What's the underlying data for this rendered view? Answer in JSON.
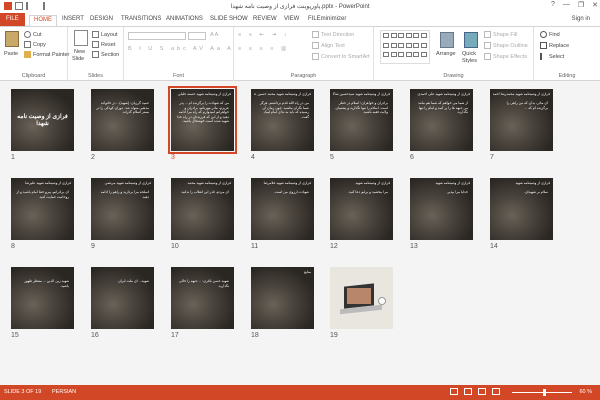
{
  "window": {
    "title": "پاورپوینت فرازی از وصیت نامه شهدا.pptx - PowerPoint",
    "controls": [
      "?",
      "—",
      "❐",
      "✕"
    ],
    "signin": "Sign in"
  },
  "tabs": [
    "FILE",
    "HOME",
    "INSERT",
    "DESIGN",
    "TRANSITIONS",
    "ANIMATIONS",
    "SLIDE SHOW",
    "REVIEW",
    "VIEW",
    "FILEminimizer"
  ],
  "ribbon": {
    "clipboard": {
      "label": "Clipboard",
      "paste": "Paste",
      "cut": "Cut",
      "copy": "Copy",
      "format_painter": "Format Painter"
    },
    "slides": {
      "label": "Slides",
      "new_slide": "New",
      "new_slide2": "Slide",
      "layout": "Layout",
      "reset": "Reset",
      "section": "Section"
    },
    "font": {
      "label": "Font"
    },
    "paragraph": {
      "label": "Paragraph",
      "text_direction": "Text Direction",
      "align_text": "Align Text",
      "convert_smartart": "Convert to SmartArt"
    },
    "drawing": {
      "label": "Drawing",
      "arrange": "Arrange",
      "quick_styles": "Quick",
      "quick_styles2": "Styles",
      "shape_fill": "Shape Fill",
      "shape_outline": "Shape Outline",
      "shape_effects": "Shape Effects"
    },
    "editing": {
      "label": "Editing",
      "find": "Find",
      "replace": "Replace",
      "select": "Select"
    }
  },
  "slides": [
    {
      "n": "1",
      "type": "title",
      "big": "فرازی از وصیت نامه شهدا"
    },
    {
      "n": "2",
      "type": "text",
      "hdr": "",
      "text": "حمید گرزیان: (شهید)... در خانواده مذهبی متولد شد. دوران کودکی را در بستر اسلام گذراند."
    },
    {
      "n": "3",
      "type": "text",
      "hdr": "فرازی از وصیتنامه شهید حسنه خلیلی",
      "text": "من که شهادت را برگزیده ام ... پدر عزیزم، مادر مهربانم، برادران و خواهرانم امیدوارم که راه مرا ادامه دهید و از این که فرزندتان در راه خدا شهید شده است خوشحال باشید."
    },
    {
      "n": "4",
      "type": "text",
      "hdr": "فرازی از وصیتنامه شهید محمد حسین عزیزی",
      "text": "من در راه الله قدم برداشتم. هرگز شما نگران نباشید. چون زمان آن رسیده که باید به ندای امام لبیک گفت."
    },
    {
      "n": "5",
      "type": "text",
      "hdr": "فرازی از وصیتنامه شهید سیدحسین شاکری",
      "text": "برادران و خواهران؛ اسلام در خطر است. اسلام را تنها نگذارید و پشتیبان ولایت فقیه باشید."
    },
    {
      "n": "6",
      "type": "text",
      "hdr": "فرازی از وصیتنامه شهید علی احمدی",
      "text": "از شما می خواهم که شما هم مانند من جبهه ها را پر کنید و امام را تنها نگذارید."
    },
    {
      "n": "7",
      "type": "text",
      "hdr": "فرازی از وصیتنامه شهید محمدرضا احمدی",
      "text": "ای مادر، بدان که من راهی را برگزیده ام که ..."
    },
    {
      "n": "8",
      "type": "text",
      "hdr": "فرازی از وصیتنامه شهید علیرضا",
      "text": "ای برادرانم، پیرو خط امام باشید و از روحانیت حمایت کنید."
    },
    {
      "n": "9",
      "type": "text",
      "hdr": "فرازی از وصیتنامه شهید مرتضی",
      "text": "اسلحه مرا بردارید و راهم را ادامه دهید."
    },
    {
      "n": "10",
      "type": "text",
      "hdr": "فرازی از وصیتنامه شهید محمد",
      "text": "ای مردم، قدر این انقلاب را بدانید."
    },
    {
      "n": "11",
      "type": "text",
      "hdr": "فرازی از وصیتنامه شهید غلامرضا",
      "text": "شهادت آرزوی من است."
    },
    {
      "n": "12",
      "type": "text",
      "hdr": "فرازی از وصیتنامه شهید",
      "text": "مرا ببخشید و برایم دعا کنید."
    },
    {
      "n": "13",
      "type": "text",
      "hdr": "فرازی از وصیتنامه شهید",
      "text": "خدایا مرا بپذیر."
    },
    {
      "n": "14",
      "type": "text",
      "hdr": "فرازی از وصیتنامه شهید",
      "text": "سلام بر شهیدان."
    },
    {
      "n": "15",
      "type": "text",
      "hdr": "",
      "text": "شهید زین الدین ... منتظر ظهور باشید."
    },
    {
      "n": "16",
      "type": "text",
      "hdr": "",
      "text": "شهید... ای ملت ایران"
    },
    {
      "n": "17",
      "type": "text",
      "hdr": "",
      "text": "شهید حسن باقری: ... جبهه را خالی نگذارید."
    },
    {
      "n": "18",
      "type": "text",
      "hdr": "منابع",
      "text": ""
    },
    {
      "n": "19",
      "type": "laptop"
    }
  ],
  "status": {
    "slide": "SLIDE 3 OF 19",
    "language": "PERSIAN",
    "zoom": "60 %"
  },
  "colors": {
    "accent": "#d24726"
  }
}
